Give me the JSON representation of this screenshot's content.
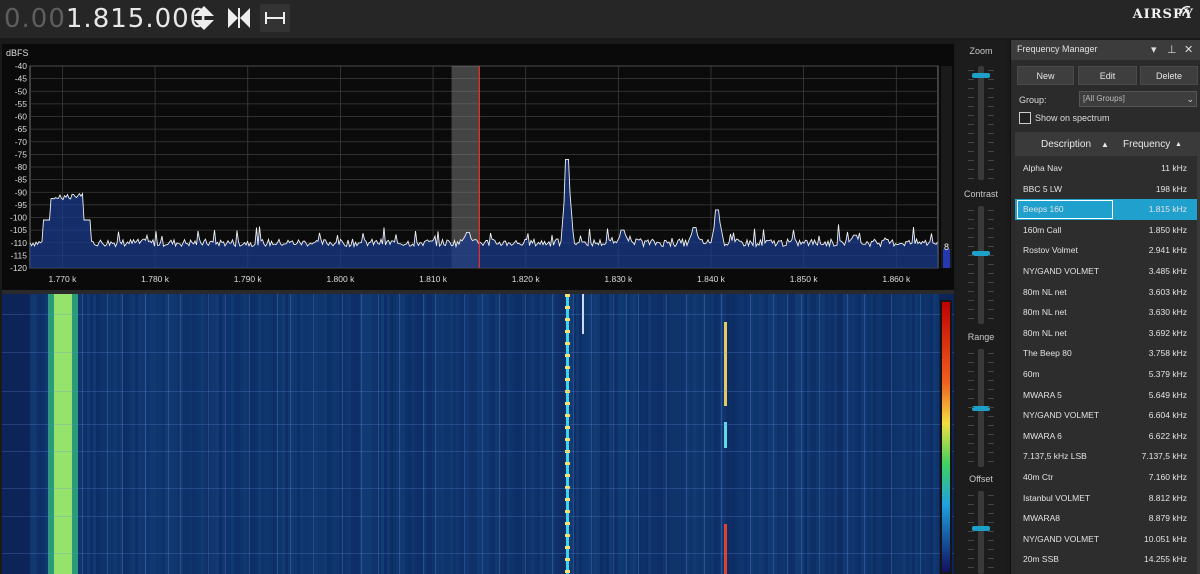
{
  "top": {
    "freq_dim": "0.00",
    "freq_bright": "1.815.000",
    "logo": "AIRSPY"
  },
  "spectrum": {
    "ylabel": "dBFS",
    "y_ticks": [
      "-40",
      "-45",
      "-50",
      "-55",
      "-60",
      "-65",
      "-70",
      "-75",
      "-80",
      "-85",
      "-90",
      "-95",
      "-100",
      "-105",
      "-110",
      "-115",
      "-120"
    ],
    "x_ticks": [
      "1.770 k",
      "1.780 k",
      "1.790 k",
      "1.800 k",
      "1.810 k",
      "1.820 k",
      "1.830 k",
      "1.840 k",
      "1.850 k",
      "1.860 k"
    ],
    "level_value": "8"
  },
  "chart_data": {
    "type": "line",
    "title": "",
    "xlabel": "",
    "ylabel": "dBFS",
    "xlim": [
      1.7665,
      1.8645
    ],
    "ylim": [
      -120,
      -40
    ],
    "grid": true,
    "x_unit": "MHz (labelled as k)",
    "noise_floor": -110,
    "peaks": [
      {
        "x": 1.7705,
        "y": -92
      },
      {
        "x": 1.8245,
        "y": -77
      },
      {
        "x": 1.8407,
        "y": -97
      },
      {
        "x": 1.8137,
        "y": -106
      },
      {
        "x": 1.8305,
        "y": -105
      },
      {
        "x": 1.8382,
        "y": -104
      },
      {
        "x": 1.8555,
        "y": -107
      }
    ],
    "passband": [
      1.812,
      1.815
    ],
    "tuned_frequency": 1.815
  },
  "sliders": {
    "zoom_label": "Zoom",
    "contrast_label": "Contrast",
    "range_label": "Range",
    "offset_label": "Offset",
    "zoom_level": 0.92,
    "contrast_level": 0.6,
    "range_level": 0.5,
    "offset_level": 0.55
  },
  "freq_manager": {
    "title": "Frequency Manager",
    "new_label": "New",
    "edit_label": "Edit",
    "delete_label": "Delete",
    "group_label": "Group:",
    "group_value": "[All Groups]",
    "show_on_spectrum": "Show on spectrum",
    "col_description": "Description",
    "col_frequency": "Frequency",
    "rows": [
      {
        "d": "Alpha Nav",
        "f": "11 kHz"
      },
      {
        "d": "BBC 5 LW",
        "f": "198 kHz"
      },
      {
        "d": "Beeps 160",
        "f": "1.815 kHz",
        "selected": true
      },
      {
        "d": "160m Call",
        "f": "1.850 kHz"
      },
      {
        "d": "Rostov Volmet",
        "f": "2.941 kHz"
      },
      {
        "d": "NY/GAND VOLMET",
        "f": "3.485 kHz"
      },
      {
        "d": "80m NL net",
        "f": "3.603 kHz"
      },
      {
        "d": "80m NL net",
        "f": "3.630 kHz"
      },
      {
        "d": "80m NL net",
        "f": "3.692 kHz"
      },
      {
        "d": "The Beep 80",
        "f": "3.758 kHz"
      },
      {
        "d": "60m",
        "f": "5.379 kHz"
      },
      {
        "d": "MWARA 5",
        "f": "5.649 kHz"
      },
      {
        "d": "NY/GAND VOLMET",
        "f": "6.604 kHz"
      },
      {
        "d": "MWARA 6",
        "f": "6.622 kHz"
      },
      {
        "d": "7.137,5 kHz LSB",
        "f": "7.137,5 kHz"
      },
      {
        "d": "40m Ctr",
        "f": "7.160 kHz"
      },
      {
        "d": "Istanbul VOLMET",
        "f": "8.812 kHz"
      },
      {
        "d": "MWARA8",
        "f": "8.879 kHz"
      },
      {
        "d": "NY/GAND VOLMET",
        "f": "10.051 kHz"
      },
      {
        "d": "20m SSB",
        "f": "14.255 kHz"
      }
    ]
  }
}
